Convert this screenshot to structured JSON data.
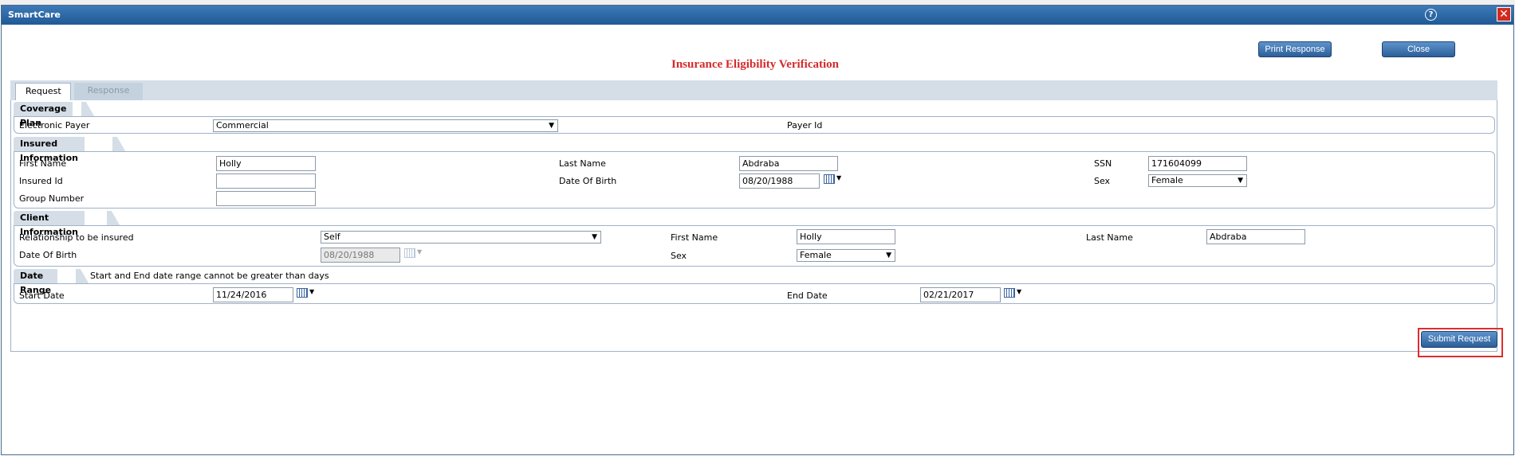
{
  "window": {
    "title": "SmartCare",
    "help_glyph": "?",
    "close_glyph": "✕"
  },
  "toolbar": {
    "print_label": "Print Response",
    "close_label": "Close"
  },
  "page_title": "Insurance Eligibility Verification",
  "tabs": [
    {
      "label": "Request"
    },
    {
      "label": "Response"
    }
  ],
  "coverage": {
    "title": "Coverage Plan",
    "payer_label": "Electronic Payer",
    "payer_value": "Commercial",
    "payer_id_label": "Payer Id"
  },
  "insured": {
    "title": "Insured Information",
    "first_name_label": "First Name",
    "first_name": "Holly",
    "last_name_label": "Last Name",
    "last_name": "Abdraba",
    "ssn_label": "SSN",
    "ssn": "171604099",
    "insured_id_label": "Insured Id",
    "insured_id": "",
    "dob_label": "Date Of Birth",
    "dob": "08/20/1988",
    "sex_label": "Sex",
    "sex": "Female",
    "group_label": "Group Number",
    "group": ""
  },
  "client": {
    "title": "Client Information",
    "relationship_label": "Relationship to be insured",
    "relationship": "Self",
    "first_name_label": "First Name",
    "first_name": "Holly",
    "last_name_label": "Last Name",
    "last_name": "Abdraba",
    "dob_label": "Date Of Birth",
    "dob": "08/20/1988",
    "sex_label": "Sex",
    "sex": "Female"
  },
  "date_range": {
    "title": "Date Range",
    "note": "Start and End date range cannot be greater than days",
    "start_label": "Start Date",
    "start": "11/24/2016",
    "end_label": "End Date",
    "end": "02/21/2017"
  },
  "submit_label": "Submit Request",
  "arrow_glyph": "▼"
}
